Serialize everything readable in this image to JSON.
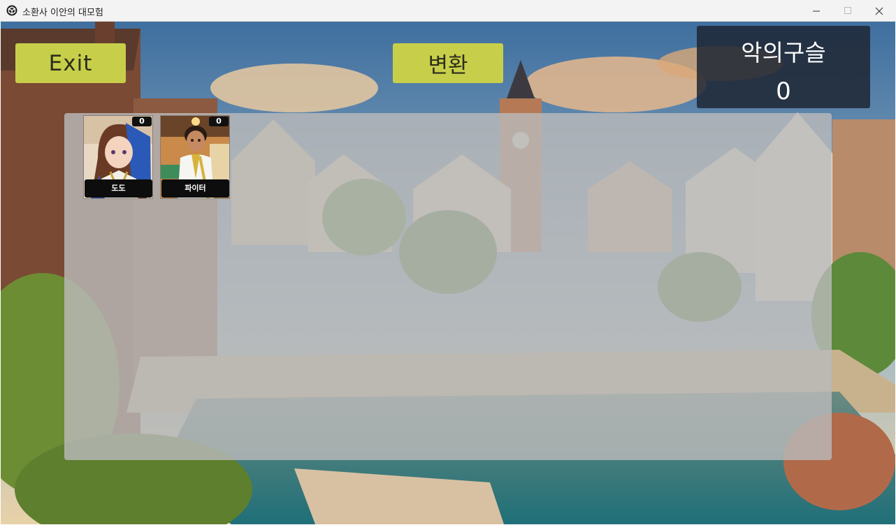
{
  "window": {
    "title": "소환사 이안의 대모험"
  },
  "toolbar": {
    "exit_label": "Exit",
    "convert_label": "변환"
  },
  "counter": {
    "label": "악의구슬",
    "value": "0"
  },
  "inventory": {
    "cards": [
      {
        "name": "도도",
        "count": "0"
      },
      {
        "name": "파이터",
        "count": "0"
      }
    ]
  },
  "colors": {
    "button": "#c7cf4a",
    "panel": "#1e2634",
    "inventory_bg": "#b9b9b9"
  },
  "icons": {
    "app": "unity-cube-icon",
    "minimize": "minimize-icon",
    "maximize": "maximize-icon",
    "close": "close-icon"
  }
}
